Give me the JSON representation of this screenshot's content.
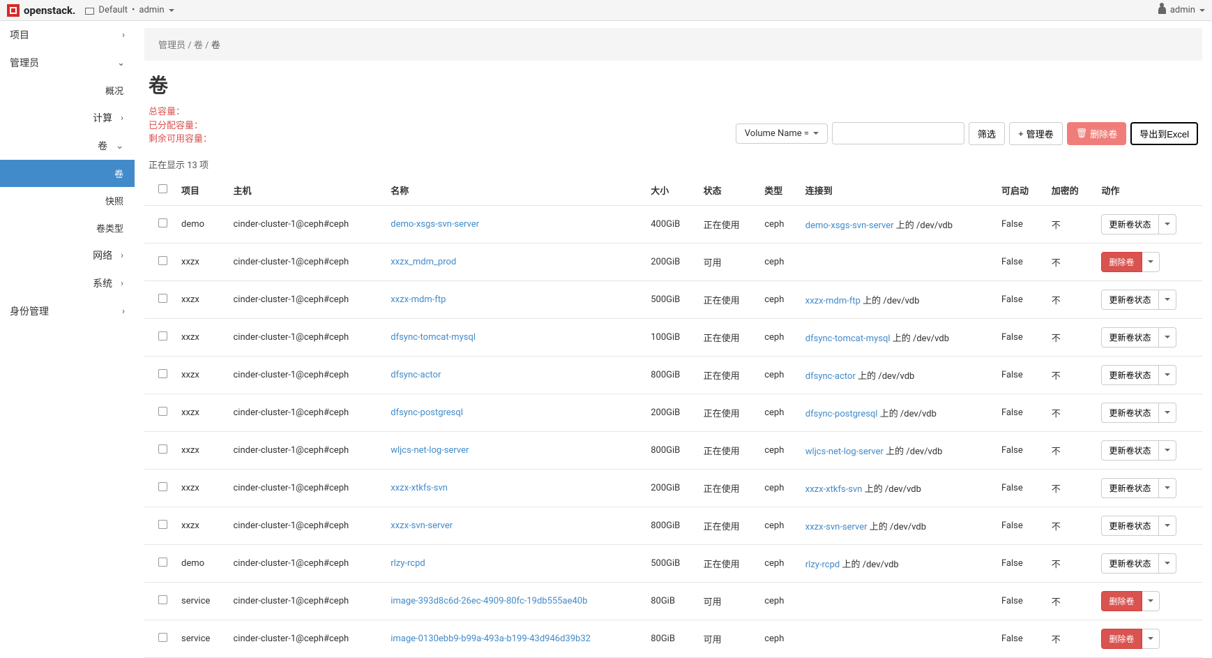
{
  "topbar": {
    "brand": "openstack.",
    "domain": "Default",
    "project": "admin",
    "user": "admin"
  },
  "sidebar": {
    "project": "项目",
    "admin": "管理员",
    "overview": "概况",
    "compute": "计算",
    "volume": "卷",
    "volumes": "卷",
    "snapshots": "快照",
    "volume_types": "卷类型",
    "network": "网络",
    "system": "系统",
    "identity": "身份管理"
  },
  "breadcrumb": {
    "a": "管理员",
    "b": "卷",
    "c": "卷"
  },
  "page_title": "卷",
  "red": {
    "total": "总容量：",
    "allocated": "已分配容量：",
    "remaining": "剩余可用容量："
  },
  "filter": {
    "label": "Volume Name ="
  },
  "buttons": {
    "filter": "筛选",
    "manage": "管理卷",
    "delete": "删除卷",
    "export": "导出到Excel"
  },
  "display_count": "正在显示 13 项",
  "columns": {
    "project": "项目",
    "host": "主机",
    "name": "名称",
    "size": "大小",
    "status": "状态",
    "type": "类型",
    "attached": "连接到",
    "bootable": "可启动",
    "encrypted": "加密的",
    "actions": "动作"
  },
  "action_labels": {
    "update": "更新卷状态",
    "delete": "删除卷"
  },
  "attach_suffix_a": " 上的 ",
  "rows": [
    {
      "project": "demo",
      "host": "cinder-cluster-1@ceph#ceph",
      "name": "demo-xsgs-svn-server",
      "size": "400GiB",
      "status": "正在使用",
      "type": "ceph",
      "attach_instance": "demo-xsgs-svn-server",
      "attach_dev": "/dev/vdb",
      "bootable": "False",
      "encrypted": "不",
      "action": "update"
    },
    {
      "project": "xxzx",
      "host": "cinder-cluster-1@ceph#ceph",
      "name": "xxzx_mdm_prod",
      "size": "200GiB",
      "status": "可用",
      "type": "ceph",
      "attach_instance": "",
      "attach_dev": "",
      "bootable": "False",
      "encrypted": "不",
      "action": "delete"
    },
    {
      "project": "xxzx",
      "host": "cinder-cluster-1@ceph#ceph",
      "name": "xxzx-mdm-ftp",
      "size": "500GiB",
      "status": "正在使用",
      "type": "ceph",
      "attach_instance": "xxzx-mdm-ftp",
      "attach_dev": "/dev/vdb",
      "bootable": "False",
      "encrypted": "不",
      "action": "update"
    },
    {
      "project": "xxzx",
      "host": "cinder-cluster-1@ceph#ceph",
      "name": "dfsync-tomcat-mysql",
      "size": "100GiB",
      "status": "正在使用",
      "type": "ceph",
      "attach_instance": "dfsync-tomcat-mysql",
      "attach_dev": "/dev/vdb",
      "bootable": "False",
      "encrypted": "不",
      "action": "update"
    },
    {
      "project": "xxzx",
      "host": "cinder-cluster-1@ceph#ceph",
      "name": "dfsync-actor",
      "size": "800GiB",
      "status": "正在使用",
      "type": "ceph",
      "attach_instance": "dfsync-actor",
      "attach_dev": "/dev/vdb",
      "bootable": "False",
      "encrypted": "不",
      "action": "update"
    },
    {
      "project": "xxzx",
      "host": "cinder-cluster-1@ceph#ceph",
      "name": "dfsync-postgresql",
      "size": "200GiB",
      "status": "正在使用",
      "type": "ceph",
      "attach_instance": "dfsync-postgresql",
      "attach_dev": "/dev/vdb",
      "bootable": "False",
      "encrypted": "不",
      "action": "update"
    },
    {
      "project": "xxzx",
      "host": "cinder-cluster-1@ceph#ceph",
      "name": "wljcs-net-log-server",
      "size": "800GiB",
      "status": "正在使用",
      "type": "ceph",
      "attach_instance": "wljcs-net-log-server",
      "attach_dev": "/dev/vdb",
      "bootable": "False",
      "encrypted": "不",
      "action": "update"
    },
    {
      "project": "xxzx",
      "host": "cinder-cluster-1@ceph#ceph",
      "name": "xxzx-xtkfs-svn",
      "size": "200GiB",
      "status": "正在使用",
      "type": "ceph",
      "attach_instance": "xxzx-xtkfs-svn",
      "attach_dev": "/dev/vdb",
      "bootable": "False",
      "encrypted": "不",
      "action": "update"
    },
    {
      "project": "xxzx",
      "host": "cinder-cluster-1@ceph#ceph",
      "name": "xxzx-svn-server",
      "size": "800GiB",
      "status": "正在使用",
      "type": "ceph",
      "attach_instance": "xxzx-svn-server",
      "attach_dev": "/dev/vdb",
      "bootable": "False",
      "encrypted": "不",
      "action": "update"
    },
    {
      "project": "demo",
      "host": "cinder-cluster-1@ceph#ceph",
      "name": "rlzy-rcpd",
      "size": "500GiB",
      "status": "正在使用",
      "type": "ceph",
      "attach_instance": "rlzy-rcpd",
      "attach_dev": "/dev/vdb",
      "bootable": "False",
      "encrypted": "不",
      "action": "update"
    },
    {
      "project": "service",
      "host": "cinder-cluster-1@ceph#ceph",
      "name": "image-393d8c6d-26ec-4909-80fc-19db555ae40b",
      "size": "80GiB",
      "status": "可用",
      "type": "ceph",
      "attach_instance": "",
      "attach_dev": "",
      "bootable": "False",
      "encrypted": "不",
      "action": "delete"
    },
    {
      "project": "service",
      "host": "cinder-cluster-1@ceph#ceph",
      "name": "image-0130ebb9-b99a-493a-b199-43d946d39b32",
      "size": "80GiB",
      "status": "可用",
      "type": "ceph",
      "attach_instance": "",
      "attach_dev": "",
      "bootable": "False",
      "encrypted": "不",
      "action": "delete"
    }
  ]
}
